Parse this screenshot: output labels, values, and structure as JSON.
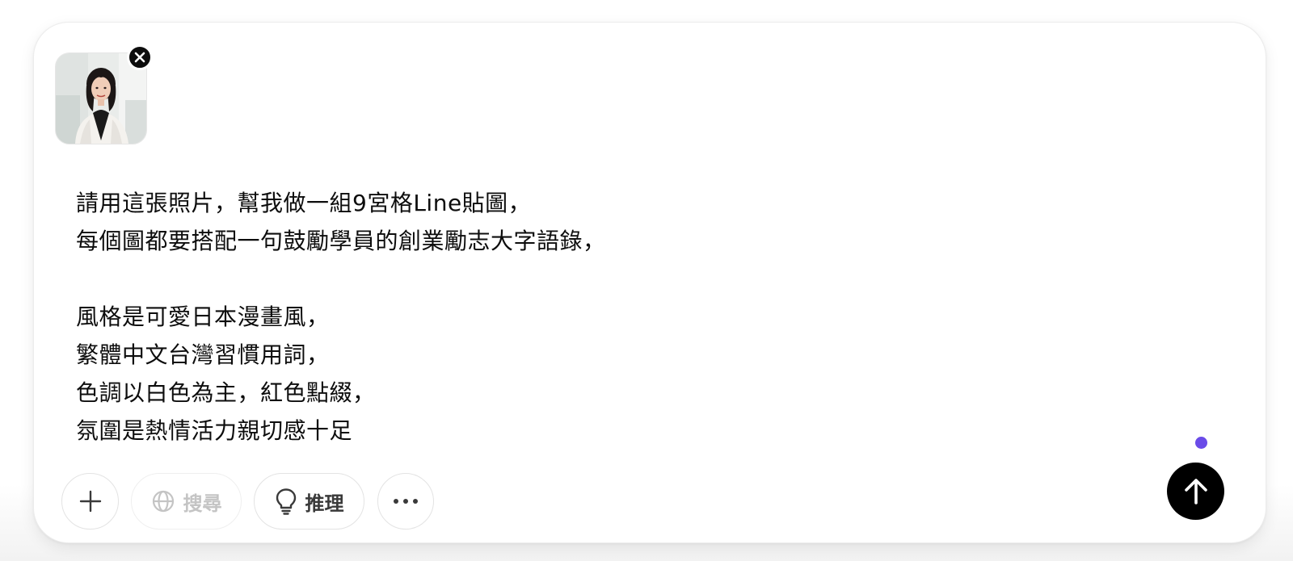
{
  "composer": {
    "prompt_lines": [
      "請用這張照片，幫我做一組9宮格Line貼圖，",
      "每個圖都要搭配一句鼓勵學員的創業勵志大字語錄，",
      "",
      "風格是可愛日本漫畫風，",
      "繁體中文台灣習慣用詞，",
      "色調以白色為主，紅色點綴，",
      "氛圍是熱情活力親切感十足"
    ],
    "attachment": {
      "icon": "photo-thumbnail",
      "remove_icon": "close-icon"
    },
    "recording_indicator_color": "#6a4be8"
  },
  "toolbar": {
    "add_icon": "plus-icon",
    "search_label": "搜尋",
    "search_icon": "globe-icon",
    "search_disabled": true,
    "reason_label": "推理",
    "reason_icon": "lightbulb-icon",
    "more_icon": "ellipsis-icon",
    "send_icon": "arrow-up-icon"
  }
}
